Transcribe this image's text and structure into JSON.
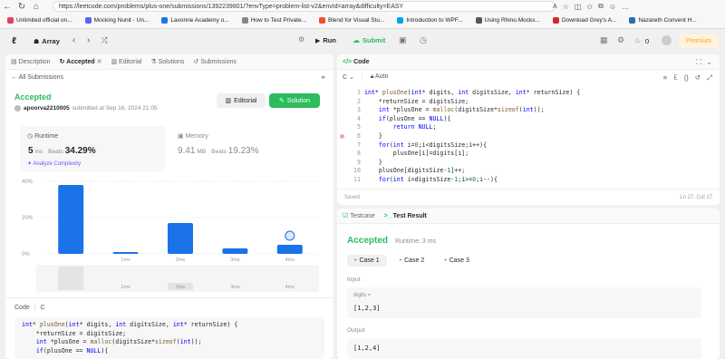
{
  "browser": {
    "url": "https://leetcode.com/problems/plus-one/submissions/1392239801/?envType=problem-list-v2&envId=array&difficulty=EASY"
  },
  "bookmarks": [
    {
      "label": "Unlimited official on...",
      "color": "#e4405f"
    },
    {
      "label": "Mocking Nunit - Un...",
      "color": "#5865f2"
    },
    {
      "label": "Lavonne Academy o...",
      "color": "#1877f2"
    },
    {
      "label": "How to Test Private...",
      "color": "#888888"
    },
    {
      "label": "Blend for Visual Stu...",
      "color": "#f25022"
    },
    {
      "label": "Introduction to WPF...",
      "color": "#00a4ef"
    },
    {
      "label": "Using Rhino.Mocks...",
      "color": "#555555"
    },
    {
      "label": "Download Grey's A...",
      "color": "#d62828"
    },
    {
      "label": "Nazareth Convent H...",
      "color": "#2b6cb0"
    }
  ],
  "nav": {
    "list_label": "Array",
    "run_label": "Run",
    "submit_label": "Submit",
    "streak_count": "0",
    "premium_label": "Premium"
  },
  "left": {
    "tabs": [
      "Description",
      "Accepted",
      "Editorial",
      "Solutions",
      "Submissions"
    ],
    "back_label": "All Submissions",
    "status": "Accepted",
    "user": "apoorva2210005",
    "submitted_text": "submitted at Sep 16, 2024 21:05",
    "editorial_button": "Editorial",
    "solution_button": "Solution",
    "runtime": {
      "title": "Runtime",
      "value": "5",
      "unit": "ms",
      "beats_label": "Beats",
      "beats_value": "34.29%",
      "analyze": "Analyze Complexity"
    },
    "memory": {
      "title": "Memory",
      "value": "9.41",
      "unit": "MB",
      "beats_label": "Beats",
      "beats_value": "19.23%"
    },
    "code_tab": "Code",
    "code_lang": "C",
    "code_lines": [
      "int* plusOne(int* digits, int digitsSize, int* returnSize) {",
      "    *returnSize = digitsSize;",
      "    int *plusOne = malloc(digitsSize*sizeof(int));",
      "    if(plusOne == NULL){"
    ]
  },
  "chart_data": {
    "type": "bar",
    "categories": [
      "",
      "1ms",
      "2ms",
      "3ms",
      "4ms"
    ],
    "values": [
      38,
      1,
      17,
      3,
      5
    ],
    "ylim": [
      0,
      40
    ],
    "yticks": [
      "40%",
      "20%",
      "0%"
    ],
    "highlight_index": 0,
    "bar_color": "#1a73e8",
    "mini_labels": [
      "1ms",
      "2ms",
      "3ms",
      "4ms"
    ]
  },
  "code_panel": {
    "title": "Code",
    "language": "C",
    "mode": "Auto",
    "saved": "Saved",
    "cursor": "Ln 27, Col 17",
    "line_numbers": [
      "1",
      "2",
      "3",
      "4",
      "5",
      "6",
      "7",
      "8",
      "9",
      "10",
      "11"
    ],
    "lines": [
      "int* plusOne(int* digits, int digitsSize, int* returnSize) {",
      "    *returnSize = digitsSize;",
      "    int *plusOne = malloc(digitsSize*sizeof(int));",
      "    if(plusOne == NULL){",
      "        return NULL;",
      "    }",
      "    for(int i=0;i<digitsSize;i++){",
      "        plusOne[i]=digits[i];",
      "    }",
      "    plusOne[digitsSize-1]++;",
      "    for(int i=digitsSize-1;i>=0;i--){"
    ]
  },
  "test_panel": {
    "tabs": [
      "Testcase",
      "Test Result"
    ],
    "status": "Accepted",
    "runtime": "Runtime: 3 ms",
    "cases": [
      "Case 1",
      "Case 2",
      "Case 3"
    ],
    "input_label": "Input",
    "var_name": "digits =",
    "input_value": "[1,2,3]",
    "output_label": "Output",
    "output_value": "[1,2,4]"
  }
}
